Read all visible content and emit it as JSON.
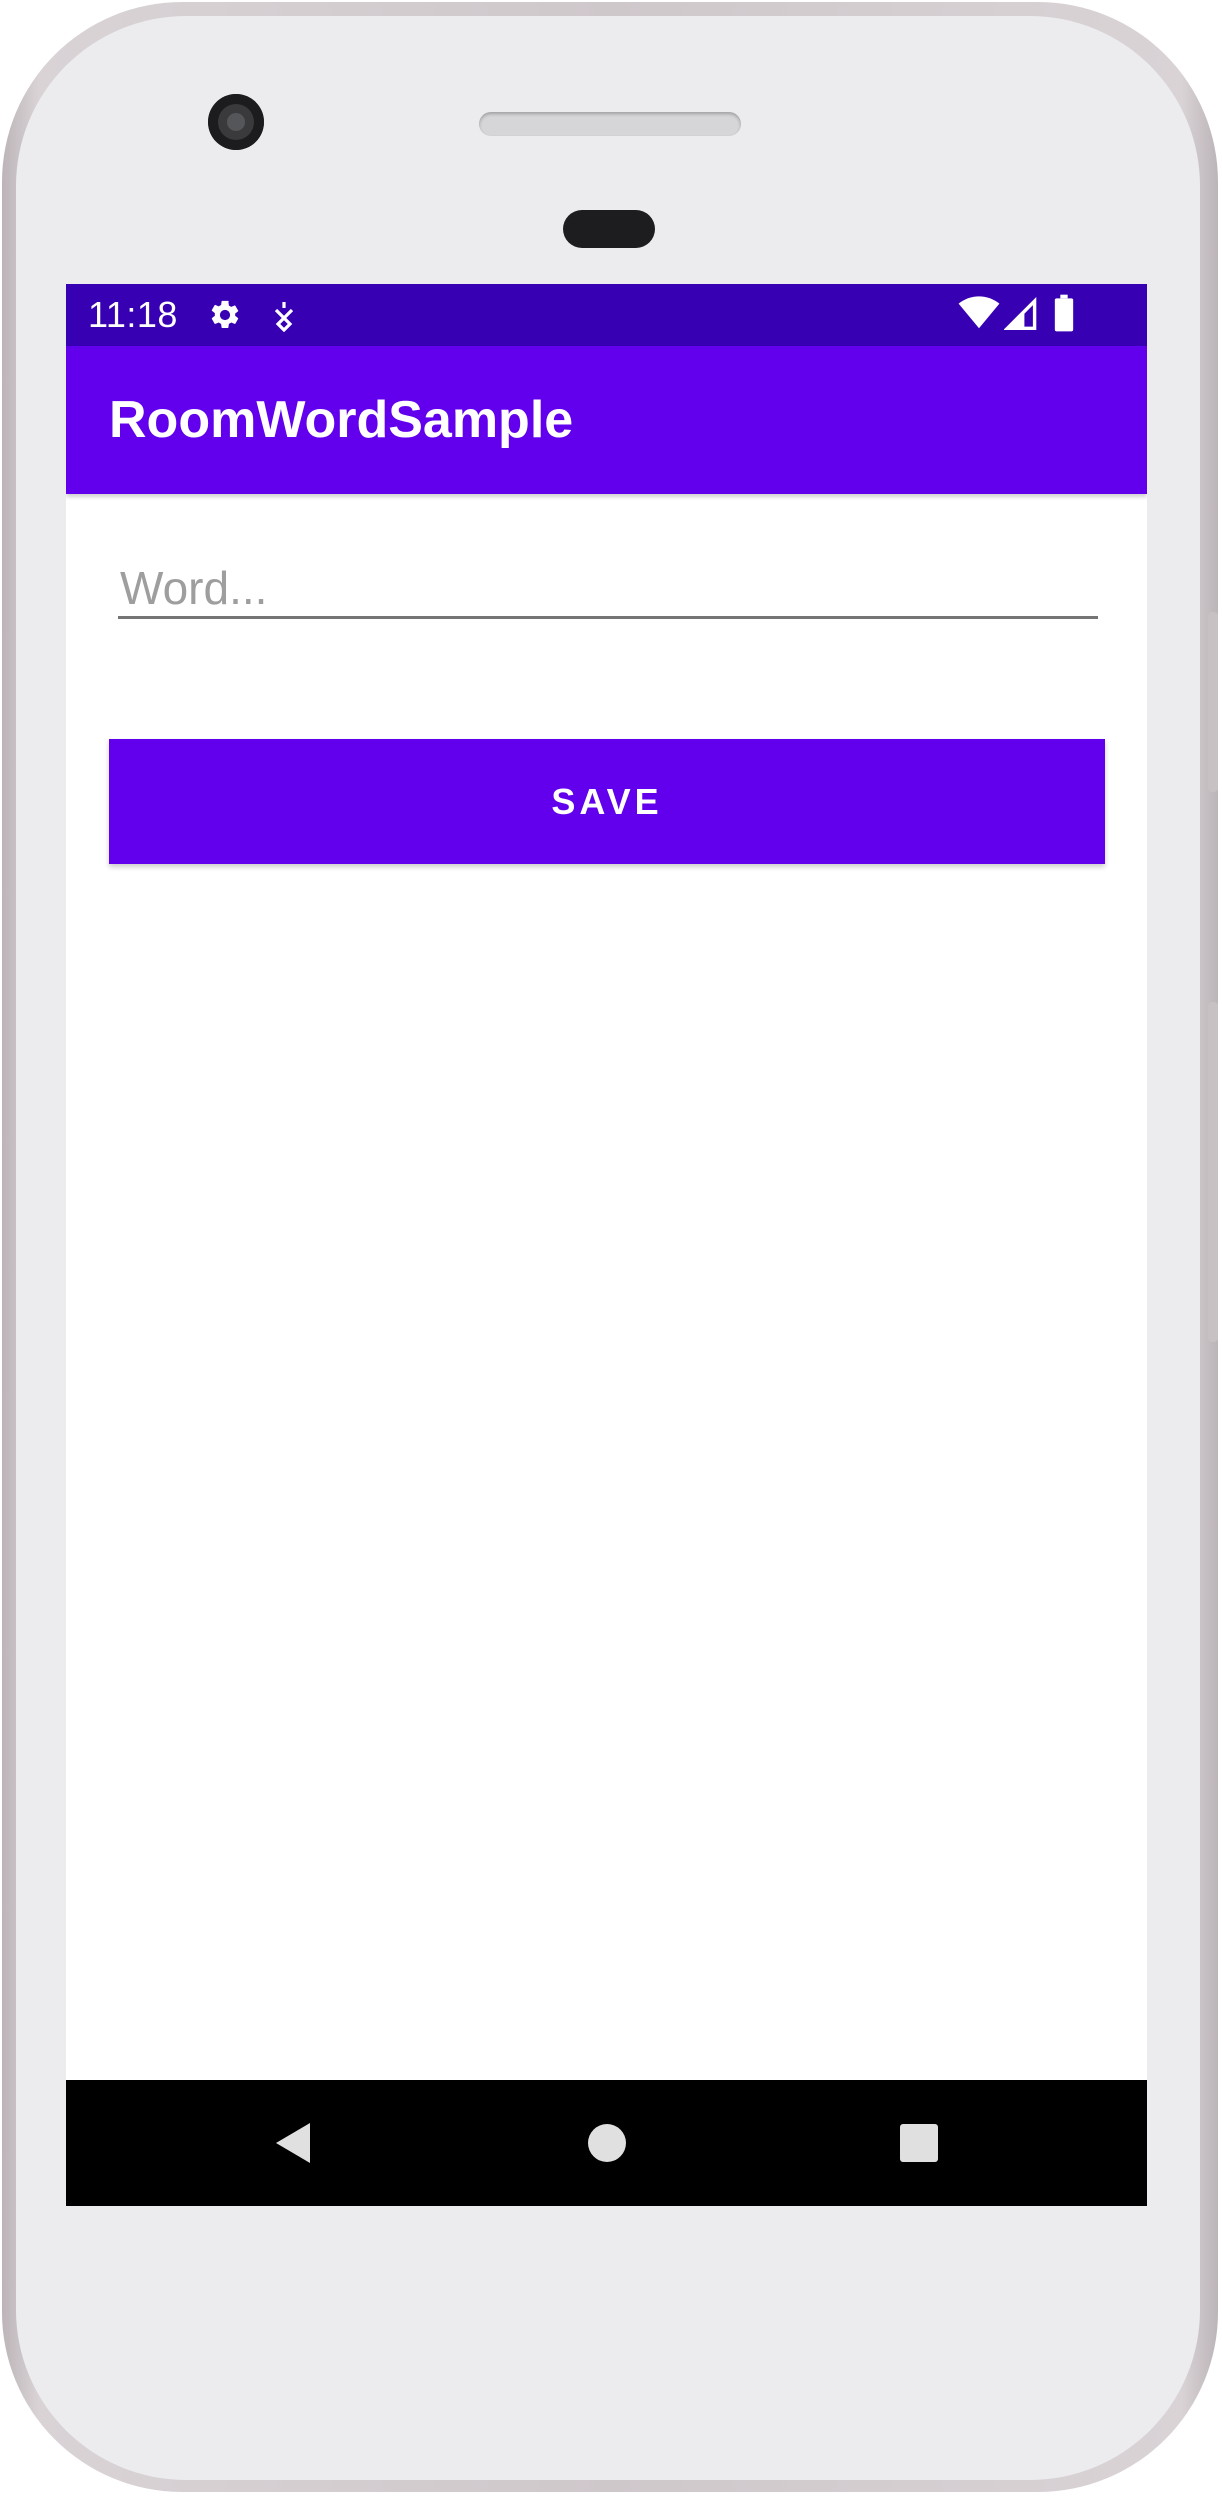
{
  "status_bar": {
    "time": "11:18",
    "icons": [
      "gear-icon",
      "notification-icon",
      "wifi-icon",
      "signal-icon",
      "battery-icon"
    ],
    "color": "#3700b3"
  },
  "app_bar": {
    "title": "RoomWordSample",
    "color": "#6200ee"
  },
  "form": {
    "word_value": "",
    "word_placeholder": "Word...",
    "save_label": "SAVE"
  },
  "nav_bar": {
    "buttons": [
      "back-icon",
      "home-icon",
      "recents-icon"
    ]
  }
}
